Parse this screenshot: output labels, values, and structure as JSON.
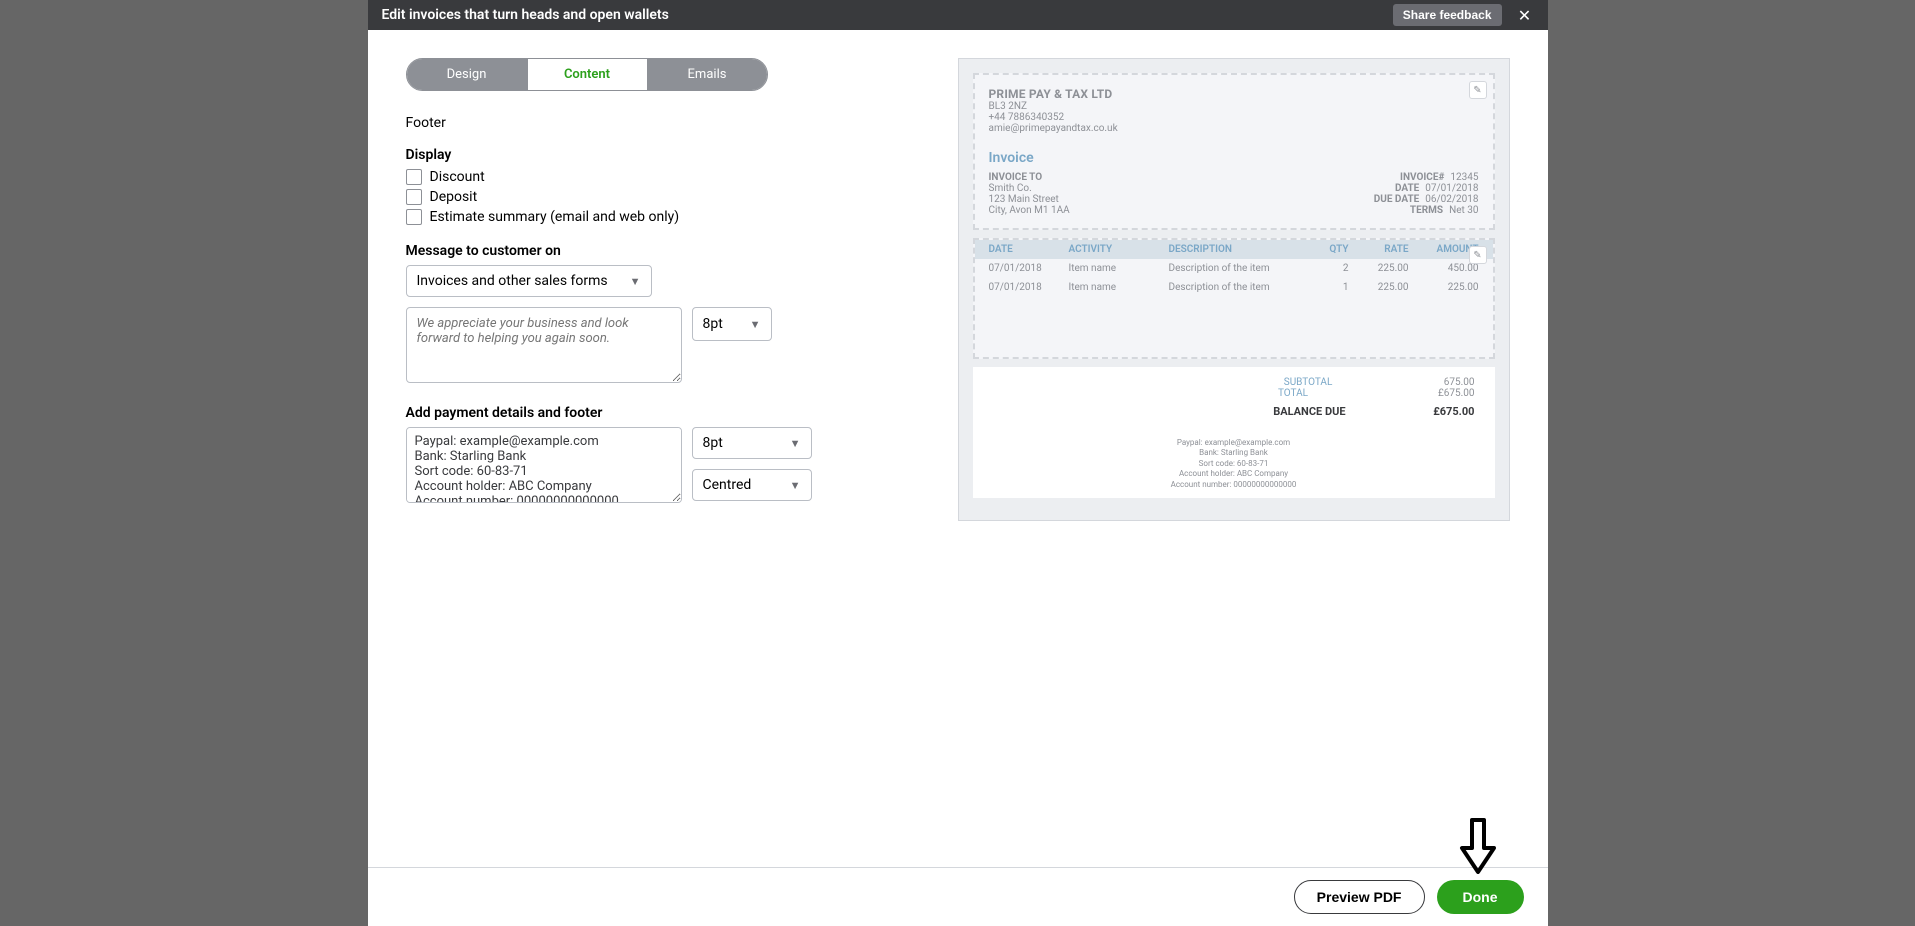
{
  "header": {
    "title": "Edit invoices that turn heads and open wallets",
    "share_label": "Share feedback"
  },
  "tabs": {
    "design": "Design",
    "content": "Content",
    "emails": "Emails"
  },
  "footer_section": {
    "heading": "Footer",
    "display_label": "Display",
    "checks": {
      "discount": "Discount",
      "deposit": "Deposit",
      "estimate": "Estimate summary (email and web only)"
    },
    "msg_label": "Message to customer on",
    "msg_doc_select": "Invoices and other sales forms",
    "msg_placeholder": "We appreciate your business and look forward to helping you again soon.",
    "msg_font_size": "8pt",
    "footer_label": "Add payment details and footer",
    "footer_text": "Paypal: example@example.com\nBank: Starling Bank\nSort code: 60-83-71\nAccount holder: ABC Company\nAccount number: 00000000000000",
    "footer_font_size": "8pt",
    "footer_align": "Centred"
  },
  "preview": {
    "company": "PRIME PAY & TAX LTD",
    "addr1": "BL3 2NZ",
    "phone": "+44 7886340352",
    "email": "amie@primepayandtax.co.uk",
    "inv_title": "Invoice",
    "bill_to_label": "INVOICE TO",
    "bill_to": [
      "Smith Co.",
      "123 Main Street",
      "City, Avon M1 1AA"
    ],
    "meta": [
      {
        "lbl": "INVOICE#",
        "val": "12345"
      },
      {
        "lbl": "DATE",
        "val": "07/01/2018"
      },
      {
        "lbl": "DUE DATE",
        "val": "06/02/2018"
      },
      {
        "lbl": "TERMS",
        "val": "Net 30"
      }
    ],
    "cols": [
      "DATE",
      "ACTIVITY",
      "DESCRIPTION",
      "QTY",
      "RATE",
      "AMOUNT"
    ],
    "rows": [
      {
        "date": "07/01/2018",
        "act": "Item name",
        "desc": "Description of the item",
        "qty": "2",
        "rate": "225.00",
        "amt": "450.00"
      },
      {
        "date": "07/01/2018",
        "act": "Item name",
        "desc": "Description of the item",
        "qty": "1",
        "rate": "225.00",
        "amt": "225.00"
      }
    ],
    "totals": {
      "subtotal_lbl": "SUBTOTAL",
      "subtotal_val": "675.00",
      "total_lbl": "TOTAL",
      "total_val": "£675.00",
      "balance_lbl": "BALANCE DUE",
      "balance_val": "£675.00"
    },
    "footer_lines": [
      "Paypal: example@example.com",
      "Bank: Starling Bank",
      "Sort code: 60-83-71",
      "Account holder: ABC Company",
      "Account number: 00000000000000"
    ]
  },
  "actions": {
    "preview": "Preview PDF",
    "done": "Done"
  }
}
